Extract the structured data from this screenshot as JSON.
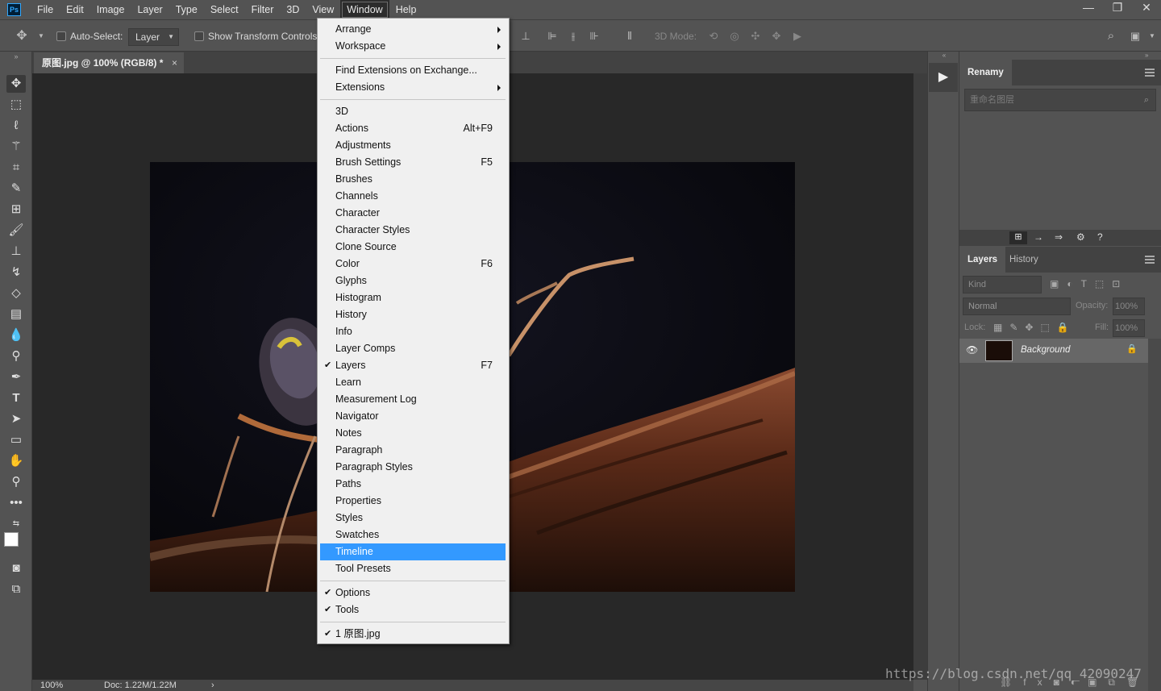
{
  "app": {
    "logo": "Ps"
  },
  "menubar": {
    "items": [
      "File",
      "Edit",
      "Image",
      "Layer",
      "Type",
      "Select",
      "Filter",
      "3D",
      "View",
      "Window",
      "Help"
    ],
    "active": "Window",
    "controls": {
      "minimize": "—",
      "restore": "❐",
      "close": "✕"
    }
  },
  "options": {
    "auto_select_label": "Auto-Select:",
    "auto_select_value": "Layer",
    "transform_label": "Show Transform Controls",
    "mode_3d_label": "3D Mode:"
  },
  "document": {
    "tab_title": "原图.jpg @ 100% (RGB/8) *",
    "close": "×",
    "zoom": "100%",
    "doc_info": "Doc: 1.22M/1.22M",
    "status_arrow": "›"
  },
  "window_menu": {
    "groups": [
      [
        {
          "label": "Arrange",
          "submenu": true
        },
        {
          "label": "Workspace",
          "submenu": true
        }
      ],
      [
        {
          "label": "Find Extensions on Exchange..."
        },
        {
          "label": "Extensions",
          "submenu": true
        }
      ],
      [
        {
          "label": "3D"
        },
        {
          "label": "Actions",
          "shortcut": "Alt+F9"
        },
        {
          "label": "Adjustments"
        },
        {
          "label": "Brush Settings",
          "shortcut": "F5"
        },
        {
          "label": "Brushes"
        },
        {
          "label": "Channels"
        },
        {
          "label": "Character"
        },
        {
          "label": "Character Styles"
        },
        {
          "label": "Clone Source"
        },
        {
          "label": "Color",
          "shortcut": "F6"
        },
        {
          "label": "Glyphs"
        },
        {
          "label": "Histogram"
        },
        {
          "label": "History"
        },
        {
          "label": "Info"
        },
        {
          "label": "Layer Comps"
        },
        {
          "label": "Layers",
          "shortcut": "F7",
          "checked": true
        },
        {
          "label": "Learn"
        },
        {
          "label": "Measurement Log"
        },
        {
          "label": "Navigator"
        },
        {
          "label": "Notes"
        },
        {
          "label": "Paragraph"
        },
        {
          "label": "Paragraph Styles"
        },
        {
          "label": "Paths"
        },
        {
          "label": "Properties"
        },
        {
          "label": "Styles"
        },
        {
          "label": "Swatches"
        },
        {
          "label": "Timeline",
          "highlighted": true
        },
        {
          "label": "Tool Presets"
        }
      ],
      [
        {
          "label": "Options",
          "checked": true
        },
        {
          "label": "Tools",
          "checked": true
        }
      ],
      [
        {
          "label": "1 原图.jpg",
          "checked": true
        }
      ]
    ]
  },
  "renamy_panel": {
    "tab": "Renamy",
    "search_placeholder": "重命名图层"
  },
  "layers_panel": {
    "tabs": [
      "Layers",
      "History"
    ],
    "kind_label": "Kind",
    "blend_mode": "Normal",
    "opacity_label": "Opacity:",
    "opacity_value": "100%",
    "lock_label": "Lock:",
    "fill_label": "Fill:",
    "fill_value": "100%",
    "layers": [
      {
        "name": "Background",
        "locked": true,
        "visible": true
      }
    ]
  },
  "watermark": "https://blog.csdn.net/qq_42090247",
  "colors": {
    "highlight": "#3399ff",
    "ui_bg": "#535353",
    "canvas_bg": "#282828"
  }
}
